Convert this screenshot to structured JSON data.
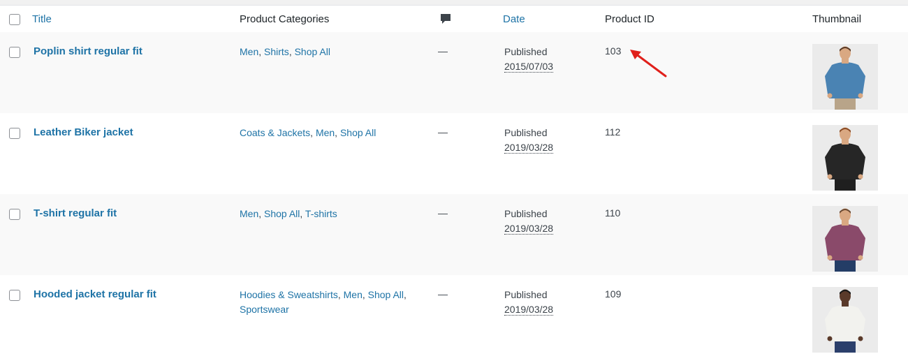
{
  "header": {
    "title": "Title",
    "categories": "Product Categories",
    "comments_icon": "comment-bubble-icon",
    "date": "Date",
    "product_id": "Product ID",
    "thumbnail": "Thumbnail"
  },
  "rows": [
    {
      "title": "Poplin shirt regular fit",
      "categories": [
        "Men",
        "Shirts",
        "Shop All"
      ],
      "comments": "—",
      "status": "Published",
      "date": "2015/07/03",
      "product_id": "103",
      "thumbnail": {
        "shirt_color": "#4a83b3",
        "background": "#ebebeb",
        "skin": "#d9a882",
        "hair": "#5a3a26",
        "pants": "#b8a489"
      }
    },
    {
      "title": "Leather Biker jacket",
      "categories": [
        "Coats & Jackets",
        "Men",
        "Shop All"
      ],
      "comments": "—",
      "status": "Published",
      "date": "2019/03/28",
      "product_id": "112",
      "thumbnail": {
        "shirt_color": "#262626",
        "background": "#ebebeb",
        "skin": "#d9a882",
        "hair": "#8a4b25",
        "pants": "#1f1f1f"
      }
    },
    {
      "title": "T-shirt regular fit",
      "categories": [
        "Men",
        "Shop All",
        "T-shirts"
      ],
      "comments": "—",
      "status": "Published",
      "date": "2019/03/28",
      "product_id": "110",
      "thumbnail": {
        "shirt_color": "#8a4a6a",
        "background": "#ebebeb",
        "skin": "#d9a882",
        "hair": "#6b4a32",
        "pants": "#243d66"
      }
    },
    {
      "title": "Hooded jacket regular fit",
      "categories": [
        "Hoodies & Sweatshirts",
        "Men",
        "Shop All",
        "Sportswear"
      ],
      "comments": "—",
      "status": "Published",
      "date": "2019/03/28",
      "product_id": "109",
      "thumbnail": {
        "shirt_color": "#f2f2ee",
        "background": "#ebebeb",
        "skin": "#5a3a2a",
        "hair": "#1a1a1a",
        "pants": "#2b3f6b"
      }
    }
  ],
  "colors": {
    "link": "#1e73a6",
    "alt_row": "#f9f9f9",
    "annotation_arrow": "#e0201b"
  }
}
